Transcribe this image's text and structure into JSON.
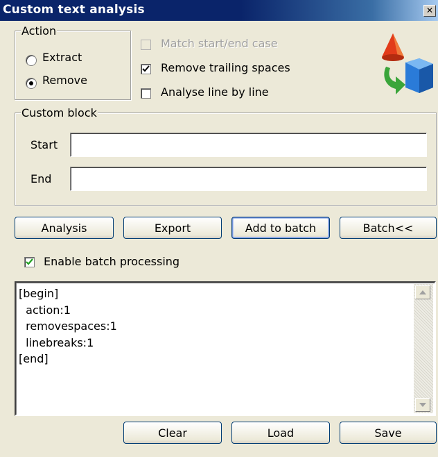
{
  "window": {
    "title": "Custom text analysis",
    "close_glyph": "✕"
  },
  "action": {
    "legend": "Action",
    "options": [
      {
        "label": "Extract",
        "selected": false
      },
      {
        "label": "Remove",
        "selected": true
      }
    ]
  },
  "options": {
    "match_case": {
      "label": "Match start/end case",
      "checked": false,
      "enabled": false
    },
    "remove_trailing": {
      "label": "Remove trailing spaces",
      "checked": true,
      "enabled": true
    },
    "line_by_line": {
      "label": "Analyse line by line",
      "checked": false,
      "enabled": true
    }
  },
  "custom_block": {
    "legend": "Custom block",
    "start_label": "Start",
    "start_value": "",
    "end_label": "End",
    "end_value": ""
  },
  "buttons": {
    "analysis": "Analysis",
    "export": "Export",
    "add_to_batch": "Add to batch",
    "batch": "Batch<<",
    "clear": "Clear",
    "load": "Load",
    "save": "Save"
  },
  "batch": {
    "enable_label": "Enable batch processing",
    "enabled": true,
    "script": "[begin]\n  action:1\n  removespaces:1\n  linebreaks:1\n[end]"
  },
  "icons": {
    "logo": "shapes-logo-icon",
    "close": "close-icon",
    "scroll_up": "scroll-up-icon",
    "scroll_down": "scroll-down-icon"
  },
  "colors": {
    "title_bar": "#0a246a",
    "dialog_bg": "#ece9d8",
    "check_green": "#21a121",
    "logo_red": "#e23b1a",
    "logo_green": "#3aa53a",
    "logo_blue": "#2a7bd8"
  }
}
